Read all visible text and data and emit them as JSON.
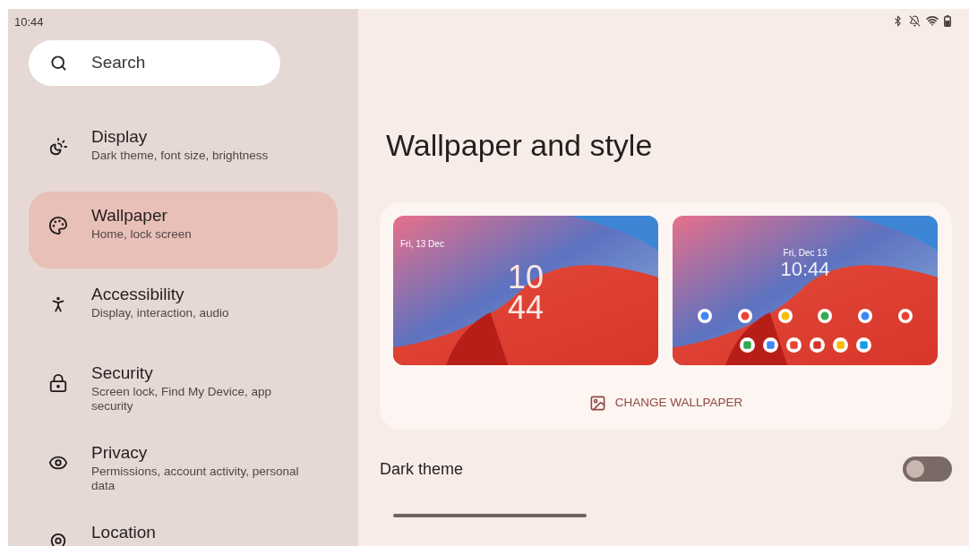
{
  "status_bar": {
    "time": "10:44"
  },
  "search": {
    "placeholder": "Search"
  },
  "sidebar": {
    "items": [
      {
        "title": "Display",
        "subtitle": "Dark theme, font size, brightness",
        "selected": false
      },
      {
        "title": "Wallpaper",
        "subtitle": "Home, lock screen",
        "selected": true
      },
      {
        "title": "Accessibility",
        "subtitle": "Display, interaction, audio",
        "selected": false
      },
      {
        "title": "Security",
        "subtitle": "Screen lock, Find My Device, app security",
        "selected": false
      },
      {
        "title": "Privacy",
        "subtitle": "Permissions, account activity, personal data",
        "selected": false
      },
      {
        "title": "Location",
        "selected": false
      }
    ]
  },
  "page": {
    "title": "Wallpaper and style",
    "lock_preview": {
      "date": "Fri, 13 Dec",
      "hour": "10",
      "minute": "44"
    },
    "home_preview": {
      "date": "Fri, Dec 13",
      "time": "10:44"
    },
    "change_button": "CHANGE WALLPAPER",
    "dark_theme": {
      "label": "Dark theme",
      "on": false
    }
  }
}
